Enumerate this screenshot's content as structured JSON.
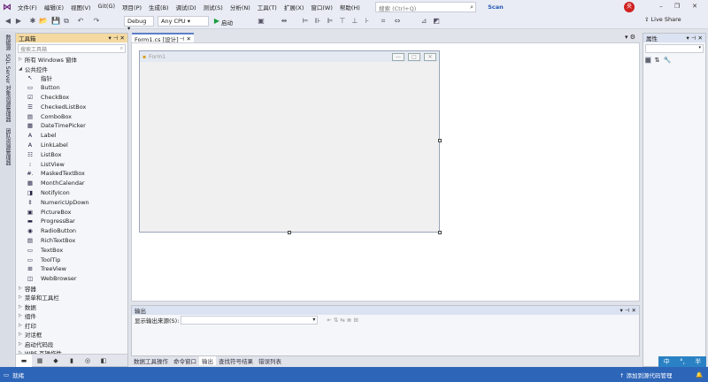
{
  "menubar": {
    "items": [
      "文件(F)",
      "编辑(E)",
      "视图(V)",
      "Git(G)",
      "项目(P)",
      "生成(B)",
      "调试(D)",
      "测试(S)",
      "分析(N)",
      "工具(T)",
      "扩展(X)",
      "窗口(W)",
      "帮助(H)"
    ],
    "search_placeholder": "搜索 (Ctrl+Q)",
    "scan_label": "Scan",
    "avatar_initial": "央"
  },
  "toolbar": {
    "config": "Debug",
    "platform": "Any CPU",
    "start_label": "启动",
    "liveshare_label": "Live Share"
  },
  "left_strip": {
    "items": [
      "数据源",
      "SQL Server 对象资源管理器",
      "团队资源管理器"
    ]
  },
  "toolbox": {
    "title": "工具箱",
    "search_placeholder": "搜索工具箱",
    "section_all": "所有 Windows 窗体",
    "section_common": "公共控件",
    "tools": [
      {
        "icon": "pointer-icon",
        "glyph": "↖",
        "label": "指针"
      },
      {
        "icon": "button-icon",
        "glyph": "▭",
        "label": "Button"
      },
      {
        "icon": "checkbox-icon",
        "glyph": "☑",
        "label": "CheckBox"
      },
      {
        "icon": "checkedlistbox-icon",
        "glyph": "☰",
        "label": "CheckedListBox"
      },
      {
        "icon": "combobox-icon",
        "glyph": "▤",
        "label": "ComboBox"
      },
      {
        "icon": "datetimepicker-icon",
        "glyph": "▦",
        "label": "DateTimePicker"
      },
      {
        "icon": "label-icon",
        "glyph": "A",
        "label": "Label"
      },
      {
        "icon": "linklabel-icon",
        "glyph": "A",
        "label": "LinkLabel"
      },
      {
        "icon": "listbox-icon",
        "glyph": "☷",
        "label": "ListBox"
      },
      {
        "icon": "listview-icon",
        "glyph": "⁝",
        "label": "ListView"
      },
      {
        "icon": "maskedtextbox-icon",
        "glyph": "#.",
        "label": "MaskedTextBox"
      },
      {
        "icon": "monthcalendar-icon",
        "glyph": "▦",
        "label": "MonthCalendar"
      },
      {
        "icon": "notifyicon-icon",
        "glyph": "◨",
        "label": "NotifyIcon"
      },
      {
        "icon": "numericupdown-icon",
        "glyph": "⇕",
        "label": "NumericUpDown"
      },
      {
        "icon": "picturebox-icon",
        "glyph": "▣",
        "label": "PictureBox"
      },
      {
        "icon": "progressbar-icon",
        "glyph": "▬",
        "label": "ProgressBar"
      },
      {
        "icon": "radiobutton-icon",
        "glyph": "◉",
        "label": "RadioButton"
      },
      {
        "icon": "richtextbox-icon",
        "glyph": "▤",
        "label": "RichTextBox"
      },
      {
        "icon": "textbox-icon",
        "glyph": "▭",
        "label": "TextBox"
      },
      {
        "icon": "tooltip-icon",
        "glyph": "▭",
        "label": "ToolTip"
      },
      {
        "icon": "treeview-icon",
        "glyph": "⊞",
        "label": "TreeView"
      },
      {
        "icon": "webbrowser-icon",
        "glyph": "◫",
        "label": "WebBrowser"
      }
    ],
    "categories": [
      "容器",
      "菜单和工具栏",
      "数据",
      "组件",
      "打印",
      "对话框",
      "启动代码段",
      "WPF 互操作性"
    ]
  },
  "document": {
    "tab_label": "Form1.cs [设计]",
    "form_title": "Form1"
  },
  "output": {
    "title": "输出",
    "source_label": "显示输出来源(S):"
  },
  "bottom_tabs": [
    "数据工具操作",
    "命令窗口",
    "输出",
    "查找符号结果",
    "错误列表"
  ],
  "properties": {
    "title": "属性"
  },
  "ime": {
    "mode": "中",
    "punct": "°,",
    "width": "半"
  },
  "statusbar": {
    "ready": "就绪",
    "source_control": "添加到源代码管理"
  }
}
